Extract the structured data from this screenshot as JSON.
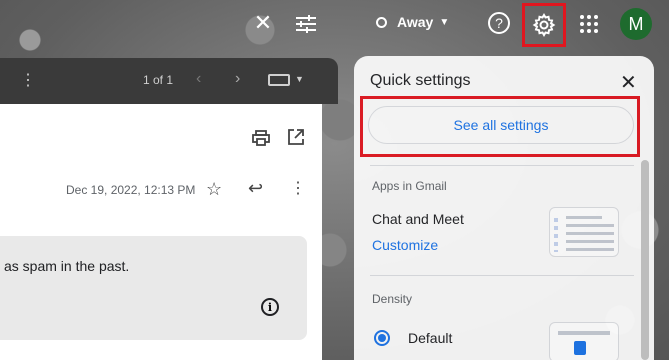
{
  "topbar": {
    "status_label": "Away",
    "avatar_initial": "M"
  },
  "mail": {
    "toolbar": {
      "pagination": "1 of 1"
    },
    "date": "Dec 19, 2022, 12:13 PM",
    "spam_message": "as spam in the past."
  },
  "quick_settings": {
    "title": "Quick settings",
    "see_all_settings": "See all settings",
    "apps_section": {
      "title": "Apps in Gmail",
      "chat_label": "Chat and Meet",
      "customize_link": "Customize"
    },
    "density_section": {
      "title": "Density",
      "selected_option": "Default"
    }
  },
  "colors": {
    "accent": "#1a73e8",
    "highlight_outline": "#e0161f",
    "avatar_bg": "#1e6b2e"
  },
  "icons": [
    "close-icon",
    "tune-icon",
    "help-icon",
    "gear-icon",
    "apps-grid-icon",
    "more-vert-icon",
    "chevron-left-icon",
    "chevron-right-icon",
    "keyboard-icon",
    "print-icon",
    "open-in-new-icon",
    "star-icon",
    "reply-icon",
    "info-icon"
  ]
}
